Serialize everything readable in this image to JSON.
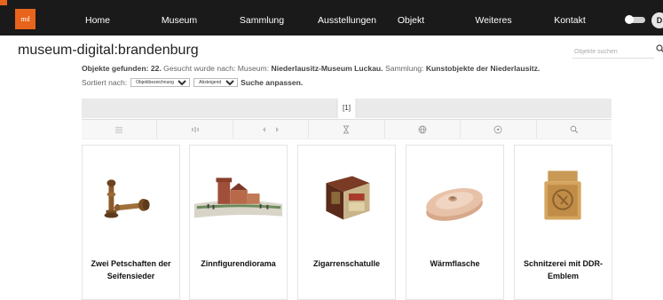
{
  "nav": {
    "logo": "md",
    "items": [
      "Home",
      "Museum",
      "Sammlung",
      "Ausstellungen",
      "Objekt",
      "Weiteres",
      "Kontakt"
    ],
    "avatar": "D"
  },
  "brand": "museum-digital:brandenburg",
  "search": {
    "placeholder": "Objekte suchen"
  },
  "summary": {
    "found_label": "Objekte gefunden: 22.",
    "searched_label": " Gesucht wurde nach: Museum: ",
    "museum": "Niederlausitz-Museum Luckau.",
    "collection_label": " Sammlung: ",
    "collection": "Kunstobjekte der Niederlausitz."
  },
  "sort": {
    "label": "Sortiert nach:",
    "field": "Objektbezeichnung",
    "order": "Absteigend",
    "adjust": "Suche anpassen."
  },
  "pager": {
    "current": "[1]"
  },
  "toolbar": [
    "list-view-icon",
    "column-view-icon",
    "slideshow-icon",
    "timeline-icon",
    "map-icon",
    "compass-icon",
    "zoom-search-icon"
  ],
  "objects": [
    "Zwei Petschaften der Seifensieder",
    "Zinnfigurendiorama",
    "Zigarrenschatulle",
    "Wärmflasche",
    "Schnitzerei mit DDR-Emblem"
  ],
  "colors": {
    "nav_bg": "#1a1a1a",
    "logo": "#e8641c",
    "pager_bg": "#eaeaea"
  }
}
